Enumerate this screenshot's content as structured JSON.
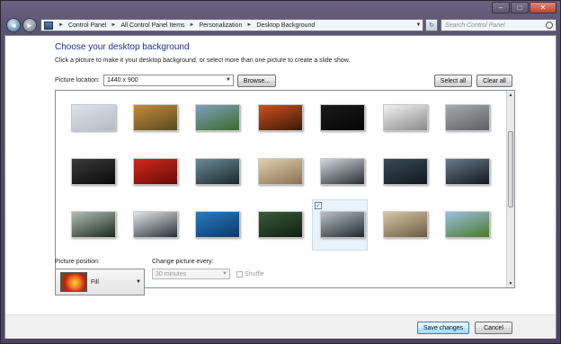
{
  "window": {
    "controls": {
      "minimize": "–",
      "maximize": "□",
      "close": "✕"
    }
  },
  "address_bar": {
    "breadcrumbs": [
      "Control Panel",
      "All Control Panel Items",
      "Personalization",
      "Desktop Background"
    ],
    "separator": "►",
    "search_placeholder": "Search Control Panel"
  },
  "page": {
    "heading": "Choose your desktop background",
    "subtext": "Click a picture to make it your desktop background, or select more than one picture to create a slide show.",
    "picture_location_label": "Picture location:",
    "picture_location_value": "1440 x 900",
    "browse_label": "Browse...",
    "select_all_label": "Select all",
    "clear_all_label": "Clear all"
  },
  "thumbnails": [
    {
      "row": 0,
      "col": 0,
      "colors": [
        "#dfe3ea",
        "#b5bac4"
      ],
      "selected": false
    },
    {
      "row": 0,
      "col": 1,
      "colors": [
        "#c48a3a",
        "#5a4a20"
      ],
      "selected": false
    },
    {
      "row": 0,
      "col": 2,
      "colors": [
        "#7fa0c0",
        "#3b6b2a"
      ],
      "selected": false
    },
    {
      "row": 0,
      "col": 3,
      "colors": [
        "#d0501a",
        "#3a1a0a"
      ],
      "selected": false
    },
    {
      "row": 0,
      "col": 4,
      "colors": [
        "#1a1a1a",
        "#050505"
      ],
      "selected": false
    },
    {
      "row": 0,
      "col": 5,
      "colors": [
        "#f2f2f2",
        "#8a8a8a"
      ],
      "selected": false
    },
    {
      "row": 0,
      "col": 6,
      "colors": [
        "#a8a9ab",
        "#5c5f64"
      ],
      "selected": false
    },
    {
      "row": 1,
      "col": 0,
      "colors": [
        "#3a3a3a",
        "#0a0a0a"
      ],
      "selected": false
    },
    {
      "row": 1,
      "col": 1,
      "colors": [
        "#d02a1a",
        "#6a0a0a"
      ],
      "selected": false
    },
    {
      "row": 1,
      "col": 2,
      "colors": [
        "#6a8a9a",
        "#1a2a2a"
      ],
      "selected": false
    },
    {
      "row": 1,
      "col": 3,
      "colors": [
        "#e0d0b0",
        "#8a7050"
      ],
      "selected": false
    },
    {
      "row": 1,
      "col": 4,
      "colors": [
        "#d0d6dc",
        "#2a2e34"
      ],
      "selected": false
    },
    {
      "row": 1,
      "col": 5,
      "colors": [
        "#3a4a52",
        "#101a20"
      ],
      "selected": false
    },
    {
      "row": 1,
      "col": 6,
      "colors": [
        "#6a7a8a",
        "#101820"
      ],
      "selected": false
    },
    {
      "row": 2,
      "col": 0,
      "colors": [
        "#b0c0b0",
        "#1a2a20"
      ],
      "selected": false
    },
    {
      "row": 2,
      "col": 1,
      "colors": [
        "#e0e6ea",
        "#2a3038"
      ],
      "selected": false
    },
    {
      "row": 2,
      "col": 2,
      "colors": [
        "#2a7ac0",
        "#0a3a6a"
      ],
      "selected": false
    },
    {
      "row": 2,
      "col": 3,
      "colors": [
        "#3a5a3a",
        "#102010"
      ],
      "selected": false
    },
    {
      "row": 2,
      "col": 4,
      "colors": [
        "#b8c0c8",
        "#202830"
      ],
      "selected": true
    },
    {
      "row": 2,
      "col": 5,
      "colors": [
        "#d8c8a8",
        "#6a5a40"
      ],
      "selected": false
    },
    {
      "row": 2,
      "col": 6,
      "colors": [
        "#9ac0e0",
        "#4a7a2a"
      ],
      "selected": false
    }
  ],
  "picture_position": {
    "label": "Picture position:",
    "value": "Fill"
  },
  "change_picture": {
    "label": "Change picture every:",
    "value": "30 minutes",
    "shuffle_label": "Shuffle"
  },
  "footer": {
    "save_label": "Save changes",
    "cancel_label": "Cancel"
  },
  "icons": {
    "back": "◄",
    "forward": "►",
    "refresh": "↻",
    "dropdown": "▼",
    "scroll_up": "▲",
    "scroll_down": "▼",
    "check": "✓"
  }
}
